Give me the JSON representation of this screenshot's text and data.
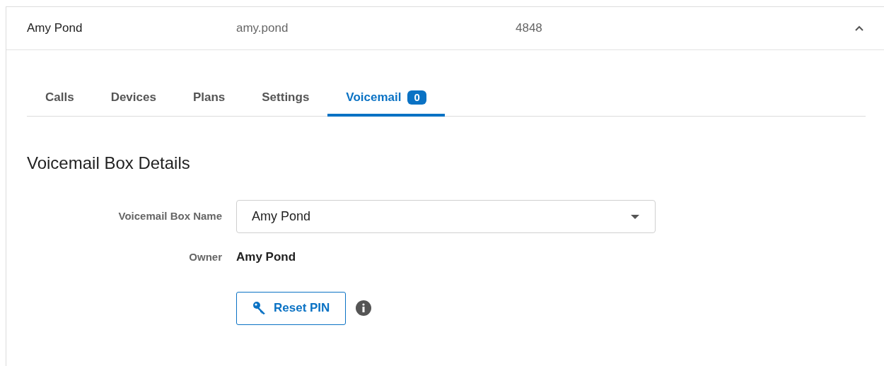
{
  "user_row": {
    "name": "Amy Pond",
    "username": "amy.pond",
    "extension": "4848",
    "expanded": true
  },
  "tabs": [
    {
      "label": "Calls",
      "selected": false
    },
    {
      "label": "Devices",
      "selected": false
    },
    {
      "label": "Plans",
      "selected": false
    },
    {
      "label": "Settings",
      "selected": false
    },
    {
      "label": "Voicemail",
      "selected": true,
      "badge": "0"
    }
  ],
  "section": {
    "title": "Voicemail Box Details",
    "fields": [
      {
        "kind": "select",
        "label": "Voicemail Box Name",
        "value": "Amy Pond"
      },
      {
        "kind": "text",
        "label": "Owner",
        "value": "Amy Pond"
      }
    ],
    "button": {
      "label": "Reset PIN"
    }
  }
}
